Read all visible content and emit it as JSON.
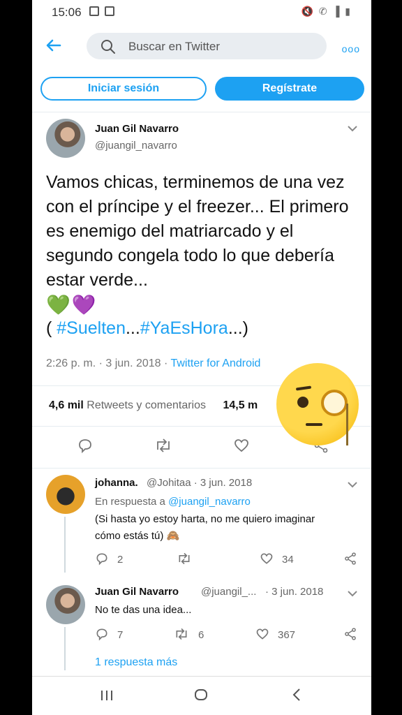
{
  "statusbar": {
    "time": "15:06",
    "right_icons": "🔇 ✆ ▐ ▮"
  },
  "topbar": {
    "search_placeholder": "Buscar en Twitter",
    "more_label": "ooo"
  },
  "auth": {
    "login_label": "Iniciar sesión",
    "signup_label": "Regístrate"
  },
  "tweet": {
    "author_name": "Juan Gil Navarro",
    "author_handle": "@juangil_navarro",
    "text": "Vamos chicas, terminemos de una vez con el príncipe y el freezer... El primero es enemigo del matriarcado y el segundo congela todo lo que debería estar verde...",
    "hashtags_open": "( ",
    "hashtag_1": "#Suelten",
    "hashtag_dots": "...",
    "hashtag_2": "#YaEsHora",
    "hashtags_close": "...)",
    "time": "2:26 p. m. · 3 jun. 2018 · ",
    "source": "Twitter for Android",
    "retweets_count": "4,6 mil",
    "retweets_label": "Retweets y comentarios",
    "likes_count": "14,5 m"
  },
  "replies": [
    {
      "name": "johanna.",
      "handle": "@Johitaa · 3 jun. 2018",
      "reply_to_label": "En respuesta a ",
      "reply_to_handle": "@juangil_navarro",
      "text_line1": "(Si hasta yo estoy harta, no me quiero imaginar",
      "text_line2": "cómo estás tú) 🙈",
      "replies": "2",
      "retweets": "",
      "likes": "34"
    },
    {
      "name": "Juan Gil Navarro",
      "handle": "@juangil_...",
      "date": "· 3 jun. 2018",
      "text": "No te das una idea...",
      "replies": "7",
      "retweets": "6",
      "likes": "367"
    }
  ],
  "more_replies": "1 respuesta más",
  "colors": {
    "accent": "#1da1f2",
    "text": "#111111",
    "muted": "#666666"
  }
}
